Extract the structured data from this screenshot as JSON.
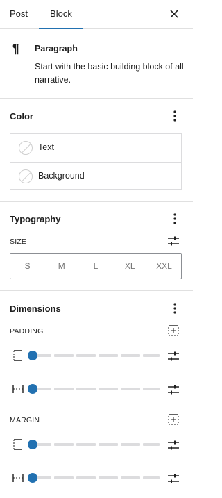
{
  "tabs": {
    "post": "Post",
    "block": "Block",
    "active": "Block"
  },
  "block": {
    "icon": "paragraph-icon",
    "title": "Paragraph",
    "description": "Start with the basic building block of all narrative."
  },
  "color": {
    "title": "Color",
    "items": [
      {
        "label": "Text",
        "icon": "empty-swatch-icon"
      },
      {
        "label": "Background",
        "icon": "empty-swatch-icon"
      }
    ]
  },
  "typography": {
    "title": "Typography",
    "size_label": "SIZE",
    "sizes": [
      "S",
      "M",
      "L",
      "XL",
      "XXL"
    ],
    "accent": "#2271b1"
  },
  "dimensions": {
    "title": "Dimensions",
    "padding_label": "PADDING",
    "margin_label": "MARGIN",
    "padding_values": [
      0,
      0
    ],
    "margin_values": [
      0,
      0
    ]
  }
}
